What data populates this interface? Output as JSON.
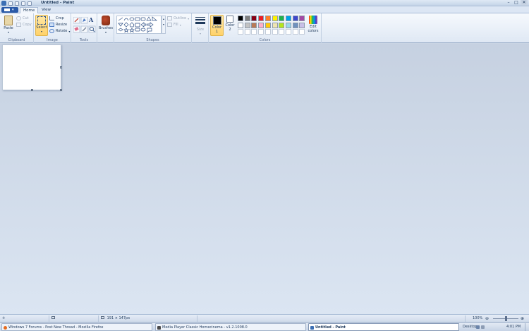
{
  "window": {
    "title": "Untitled - Paint",
    "controls": {
      "minimize": "–",
      "maximize": "□",
      "close": "✕"
    }
  },
  "tabs": [
    {
      "label": "Home",
      "active": true
    },
    {
      "label": "View",
      "active": false
    }
  ],
  "ribbon": {
    "clipboard": {
      "paste": "Paste",
      "cut": "Cut",
      "copy": "Copy",
      "group": "Clipboard"
    },
    "image": {
      "select": "Select",
      "crop": "Crop",
      "resize": "Resize",
      "rotate": "Rotate",
      "group": "Image"
    },
    "tools": {
      "group": "Tools",
      "text_glyph": "A"
    },
    "brushes": {
      "label": "Brushes"
    },
    "shapes": {
      "outline": "Outline",
      "fill": "Fill",
      "group": "Shapes"
    },
    "size": {
      "label": "Size"
    },
    "colors": {
      "color1_label": "Color 1",
      "color2_label": "Color 2",
      "edit_colors": "Edit colors",
      "group": "Colors",
      "color1": "#000000",
      "color2": "#ffffff",
      "palette_row1": [
        "#000000",
        "#7f7f7f",
        "#880015",
        "#ed1c24",
        "#ff7f27",
        "#fff200",
        "#22b14c",
        "#00a2e8",
        "#3f48cc",
        "#a349a4"
      ],
      "palette_row2": [
        "#ffffff",
        "#c3c3c3",
        "#b97a57",
        "#ffaec9",
        "#ffc90e",
        "#efe4b0",
        "#b5e61d",
        "#99d9ea",
        "#7092be",
        "#c8bfe7"
      ]
    }
  },
  "statusbar": {
    "canvas_size": "191 × 147px",
    "zoom": "100%"
  },
  "taskbar": {
    "items": [
      {
        "label": "Windows 7 Forums - Post New Thread - Mozilla Firefox",
        "active": false
      },
      {
        "label": "Media Player Classic Homecinema - v1.2.1008.0",
        "active": false
      },
      {
        "label": "Untitled - Paint",
        "active": true
      }
    ],
    "desktop": "Desktop",
    "clock": "4:01 PM"
  }
}
